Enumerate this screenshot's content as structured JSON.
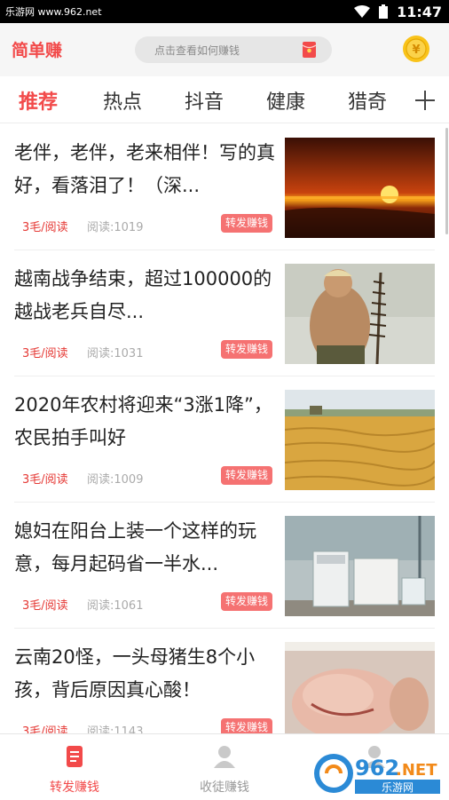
{
  "status_bar": {
    "watermark": "乐游网 www.962.net",
    "time": "11:47"
  },
  "header": {
    "title": "简单赚",
    "search_placeholder": "点击查看如何赚钱",
    "coin_glyph": "¥"
  },
  "tabs": [
    {
      "label": "推荐",
      "active": true
    },
    {
      "label": "热点",
      "active": false
    },
    {
      "label": "抖音",
      "active": false
    },
    {
      "label": "健康",
      "active": false
    },
    {
      "label": "猎奇",
      "active": false
    }
  ],
  "articles": [
    {
      "title": "老伴，老伴，老来相伴！写的真好，看落泪了！（深...",
      "reward": "3毛/阅读",
      "reads": "阅读:1019",
      "share": "转发赚钱",
      "image": "sunset"
    },
    {
      "title": "越南战争结束，超过100000的越战老兵自尽...",
      "reward": "3毛/阅读",
      "reads": "阅读:1031",
      "share": "转发赚钱",
      "image": "soldier"
    },
    {
      "title": "2020年农村将迎来“3涨1降”，农民拍手叫好",
      "reward": "3毛/阅读",
      "reads": "阅读:1009",
      "share": "转发赚钱",
      "image": "wheat-field"
    },
    {
      "title": "媳妇在阳台上装一个这样的玩意，每月起码省一半水...",
      "reward": "3毛/阅读",
      "reads": "阅读:1061",
      "share": "转发赚钱",
      "image": "washing-machine"
    },
    {
      "title": "云南20怪，一头母猪生8个小孩，背后原因真心酸！",
      "reward": "3毛/阅读",
      "reads": "阅读:1143",
      "share": "转发赚钱",
      "image": "piglet"
    }
  ],
  "bottom_nav": [
    {
      "label": "转发赚钱",
      "active": true,
      "icon": "document-icon"
    },
    {
      "label": "收徒赚钱",
      "active": false,
      "icon": "user-icon"
    },
    {
      "label": "",
      "active": false,
      "icon": "user-icon"
    }
  ],
  "site_watermark": {
    "brand": "962",
    "tld": ".NET",
    "name": "乐游网"
  },
  "colors": {
    "accent": "#f24a4a",
    "share_badge": "#f57272",
    "reward": "#e53935"
  }
}
